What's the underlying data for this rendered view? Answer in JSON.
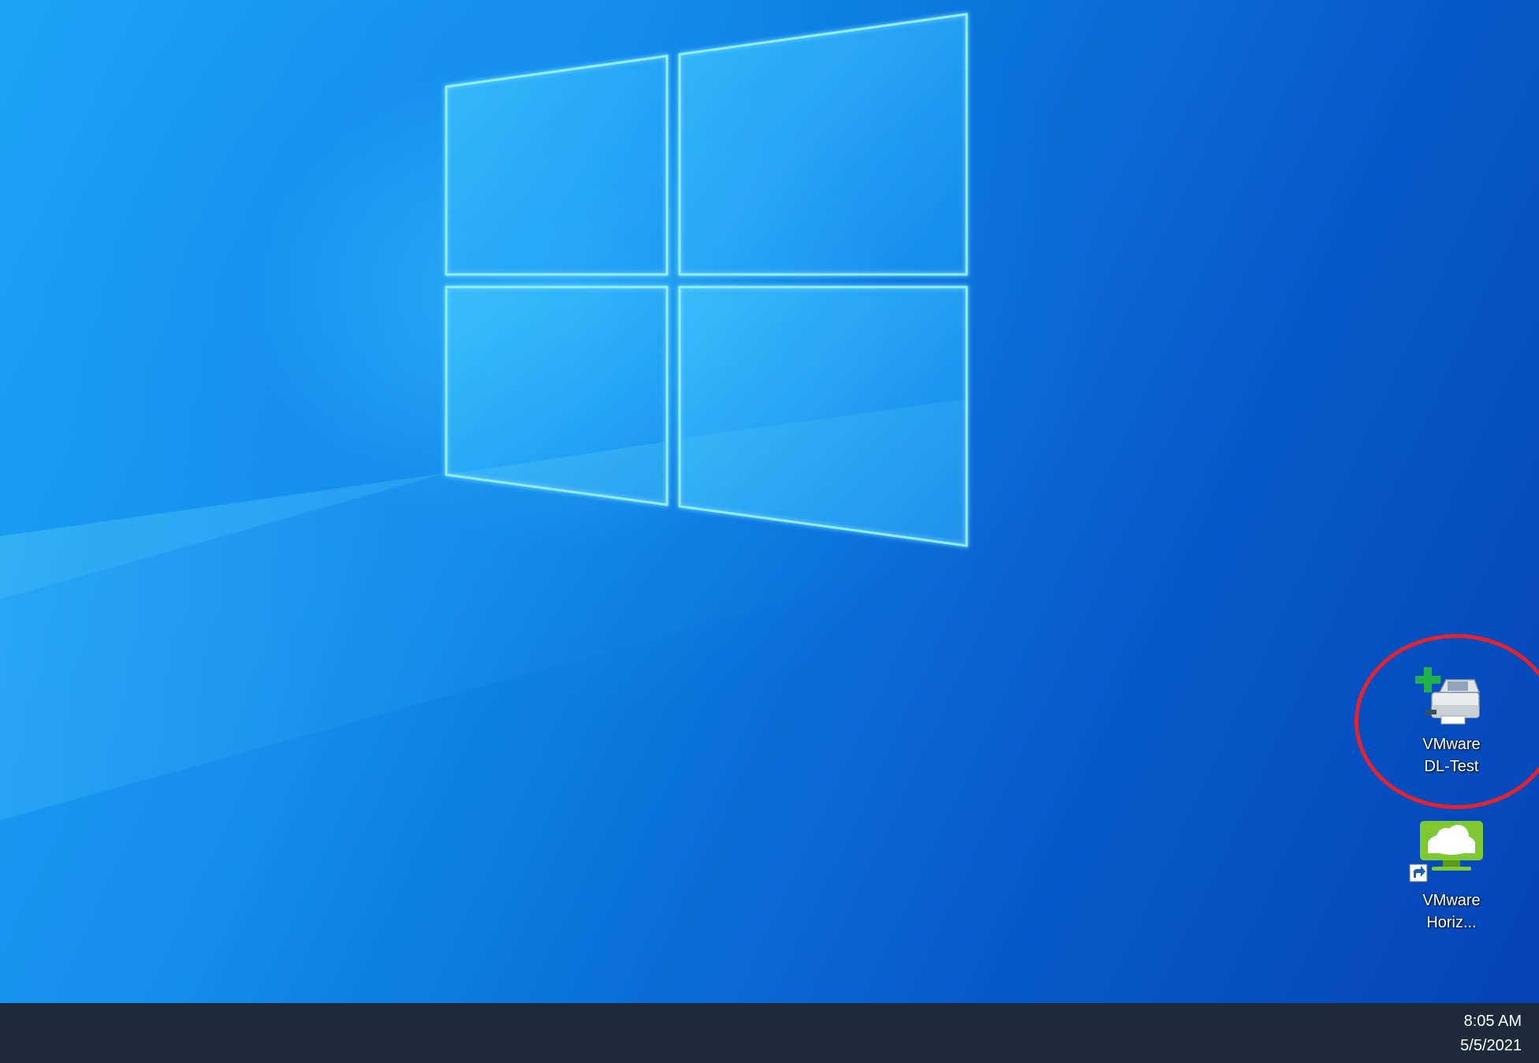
{
  "desktop": {
    "wallpaper": "windows-10-hero",
    "icons": [
      {
        "name": "printer-icon",
        "label": "VMware\nDL-Test",
        "has_add_badge": true
      },
      {
        "name": "vmware-horizon-icon",
        "label": "VMware\nHoriz...",
        "is_shortcut": true
      }
    ],
    "annotation": {
      "shape": "circle",
      "color": "#e5232e",
      "target": "VMware DL-Test"
    }
  },
  "taskbar": {
    "clock": {
      "time": "8:05 AM",
      "date": "5/5/2021"
    }
  },
  "colors": {
    "taskbar_bg": "#1c2a3b",
    "wallpaper_blue": "#0a72dc",
    "annotation_red": "#e5232e",
    "horizon_green": "#7ec832"
  }
}
